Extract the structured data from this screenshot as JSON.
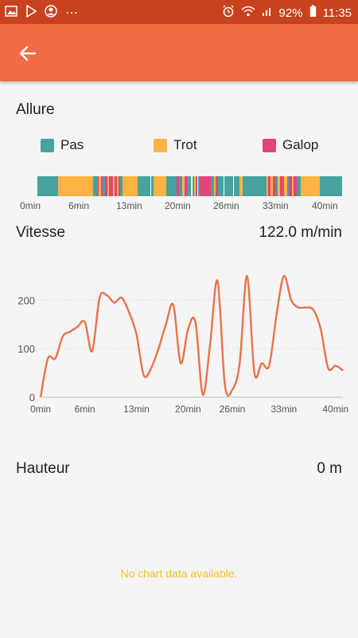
{
  "status": {
    "battery": "92%",
    "time": "11:35"
  },
  "allure": {
    "title": "Allure",
    "legend": [
      {
        "label": "Pas",
        "color": "#46a39d"
      },
      {
        "label": "Trot",
        "color": "#fdb444"
      },
      {
        "label": "Galop",
        "color": "#e2457a"
      }
    ],
    "time_labels": [
      "0min",
      "6min",
      "13min",
      "20min",
      "26min",
      "33min",
      "40min"
    ]
  },
  "vitesse": {
    "title": "Vitesse",
    "value": "122.0 m/min",
    "y_ticks": [
      "0",
      "100",
      "200"
    ],
    "x_ticks": [
      "0min",
      "6min",
      "13min",
      "20min",
      "26min",
      "33min",
      "40min"
    ]
  },
  "hauteur": {
    "title": "Hauteur",
    "value": "0 m",
    "empty_message": "No chart data available."
  },
  "colors": {
    "statusbar": "#c8421e",
    "appbar": "#ef6c44",
    "line": "#e8734a"
  },
  "chart_data": {
    "type": "line",
    "xlabel": "",
    "ylabel": "",
    "x_unit": "min",
    "ylim": [
      0,
      260
    ],
    "x": [
      0,
      1,
      2,
      3,
      4,
      5,
      6,
      7,
      8,
      9,
      10,
      11,
      12,
      13,
      14,
      15,
      16,
      17,
      18,
      19,
      20,
      21,
      22,
      23,
      24,
      25,
      26,
      27,
      28,
      29,
      30,
      31,
      32,
      33,
      34,
      35,
      36,
      37,
      38,
      39,
      40,
      41
    ],
    "series": [
      {
        "values": [
          0,
          80,
          80,
          125,
          135,
          145,
          155,
          95,
          205,
          210,
          195,
          205,
          175,
          130,
          45,
          60,
          100,
          150,
          190,
          70,
          140,
          155,
          5,
          110,
          240,
          25,
          15,
          70,
          250,
          50,
          70,
          65,
          170,
          250,
          200,
          185,
          185,
          180,
          140,
          60,
          65,
          55
        ]
      }
    ]
  }
}
